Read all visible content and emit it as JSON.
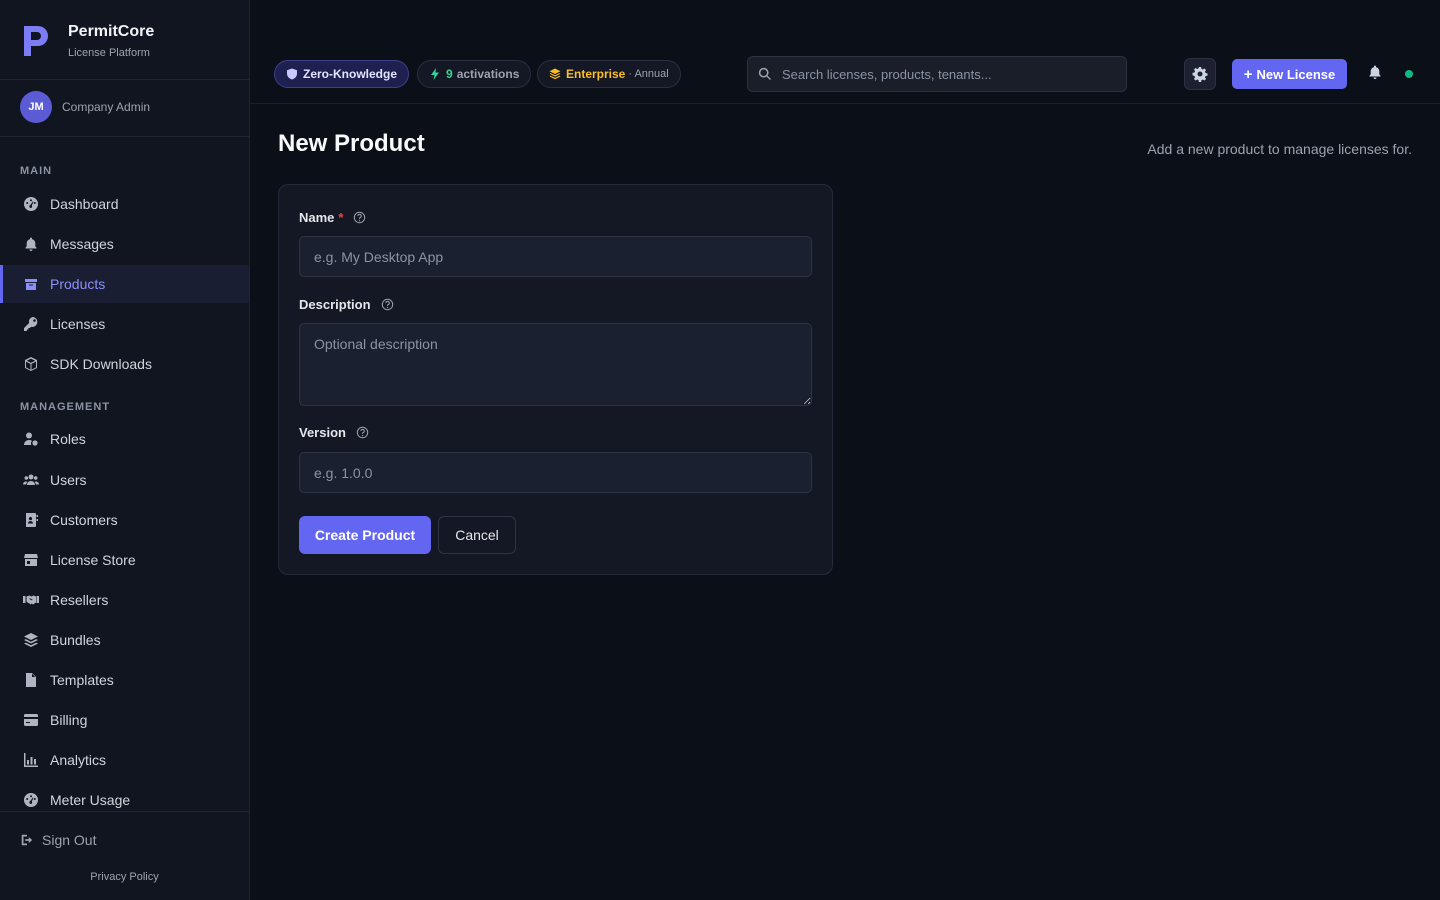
{
  "brand": {
    "name": "PermitCore",
    "subtitle": "License Platform"
  },
  "user": {
    "initials": "JM",
    "role": "Company Admin"
  },
  "nav": {
    "main_label": "MAIN",
    "management_label": "MANAGEMENT",
    "main_items": [
      {
        "label": "Dashboard",
        "icon": "gauge-icon"
      },
      {
        "label": "Messages",
        "icon": "bell-icon"
      },
      {
        "label": "Products",
        "icon": "box-icon",
        "active": true
      },
      {
        "label": "Licenses",
        "icon": "key-icon"
      },
      {
        "label": "SDK Downloads",
        "icon": "cube-icon"
      }
    ],
    "management_items": [
      {
        "label": "Roles",
        "icon": "user-gear-icon"
      },
      {
        "label": "Users",
        "icon": "users-icon"
      },
      {
        "label": "Customers",
        "icon": "address-book-icon"
      },
      {
        "label": "License Store",
        "icon": "store-icon"
      },
      {
        "label": "Resellers",
        "icon": "handshake-icon"
      },
      {
        "label": "Bundles",
        "icon": "layers-icon"
      },
      {
        "label": "Templates",
        "icon": "file-icon"
      },
      {
        "label": "Billing",
        "icon": "credit-card-icon"
      },
      {
        "label": "Analytics",
        "icon": "chart-icon"
      },
      {
        "label": "Meter Usage",
        "icon": "gauge-icon"
      }
    ],
    "sign_out": "Sign Out",
    "privacy": "Privacy Policy"
  },
  "topbar": {
    "zk_label": "Zero-Knowledge",
    "activations_count": "9",
    "activations_label": "activations",
    "plan_tier": "Enterprise",
    "plan_period": "· Annual",
    "search_placeholder": "Search licenses, products, tenants...",
    "new_license_label": "New License"
  },
  "page": {
    "title": "New Product",
    "subtitle": "Add a new product to manage licenses for."
  },
  "form": {
    "name_label": "Name",
    "required_mark": "*",
    "name_placeholder": "e.g. My Desktop App",
    "description_label": "Description",
    "description_placeholder": "Optional description",
    "version_label": "Version",
    "version_placeholder": "e.g. 1.0.0",
    "submit_label": "Create Product",
    "cancel_label": "Cancel"
  },
  "colors": {
    "accent": "#6366f1",
    "success": "#10b981",
    "warning": "#fbbf24",
    "danger": "#ef4444",
    "background": "#0b0f17"
  }
}
